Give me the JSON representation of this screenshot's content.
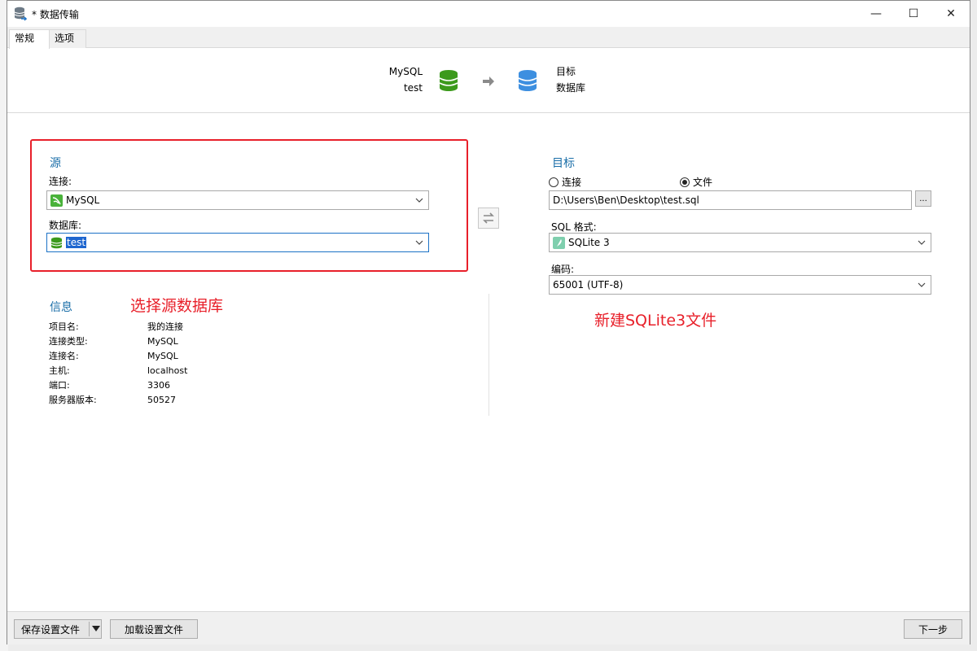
{
  "window": {
    "title": "* 数据传输",
    "controls": {
      "minimize": "—",
      "maximize": "☐",
      "close": "✕"
    }
  },
  "tabs": [
    {
      "label": "常规",
      "active": true
    },
    {
      "label": "选项",
      "active": false
    }
  ],
  "header": {
    "source_name": "MySQL",
    "source_db": "test",
    "target_name": "目标",
    "target_db": "数据库",
    "source_icon": "database-green-icon",
    "target_icon": "database-blue-icon",
    "arrow_icon": "arrow-right-icon"
  },
  "source": {
    "title": "源",
    "connection_label": "连接:",
    "connection_value": "MySQL",
    "database_label": "数据库:",
    "database_value": "test"
  },
  "info": {
    "title": "信息",
    "rows": [
      {
        "key": "项目名:",
        "value": "我的连接"
      },
      {
        "key": "连接类型:",
        "value": "MySQL"
      },
      {
        "key": "连接名:",
        "value": "MySQL"
      },
      {
        "key": "主机:",
        "value": "localhost"
      },
      {
        "key": "端口:",
        "value": "3306"
      },
      {
        "key": "服务器版本:",
        "value": "50527"
      }
    ]
  },
  "target": {
    "title": "目标",
    "radio_connection": "连接",
    "radio_file": "文件",
    "selected": "file",
    "file_path": "D:\\Users\\Ben\\Desktop\\test.sql",
    "browse_label": "...",
    "sql_format_label": "SQL 格式:",
    "sql_format_value": "SQLite 3",
    "encoding_label": "编码:",
    "encoding_value": "65001 (UTF-8)"
  },
  "annotations": {
    "source_note": "选择源数据库",
    "target_note": "新建SQLite3文件",
    "highlight_color": "#e8202a"
  },
  "footer": {
    "save_label": "保存设置文件",
    "load_label": "加载设置文件",
    "next_label": "下一步"
  }
}
